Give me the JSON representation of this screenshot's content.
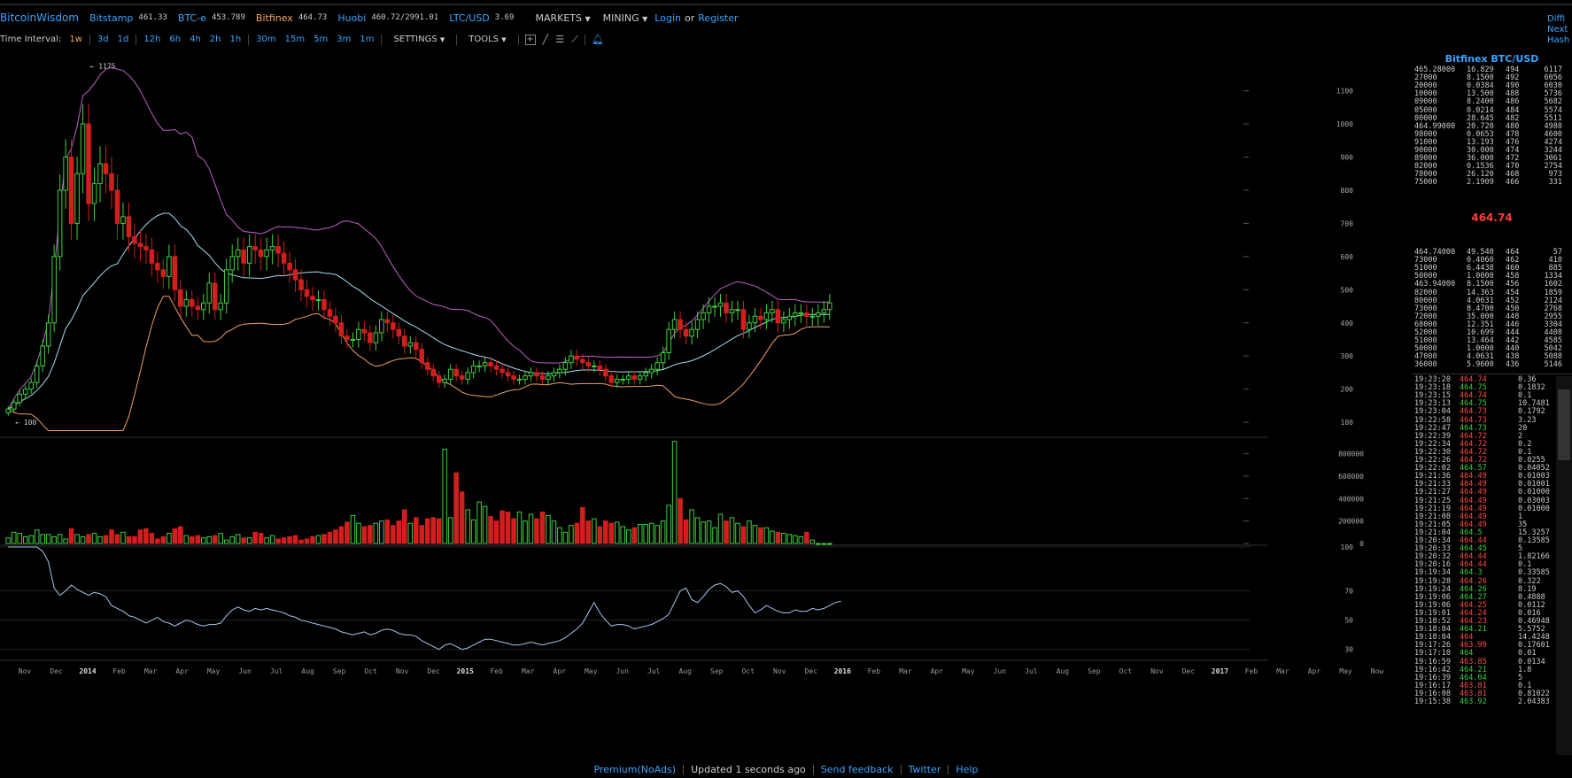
{
  "topbar": {
    "brand": "BitcoinWisdom",
    "exchanges": [
      {
        "name": "Bitstamp",
        "price": "461.33",
        "active": false
      },
      {
        "name": "BTC-e",
        "price": "453.789",
        "active": false
      },
      {
        "name": "Bitfinex",
        "price": "464.73",
        "active": true
      },
      {
        "name": "Huobi",
        "price": "460.72/2991.01",
        "active": false
      },
      {
        "name": "LTC/USD",
        "price": "3.69",
        "active": false
      }
    ],
    "markets_label": "MARKETS",
    "mining_label": "MINING",
    "login_label": "Login",
    "or_label": "or",
    "register_label": "Register",
    "right_links": [
      "Diffi",
      "Next",
      "Hash"
    ]
  },
  "toolbar": {
    "time_interval_label": "Time Interval:",
    "intervals": [
      "1w",
      "3d",
      "1d",
      "12h",
      "6h",
      "4h",
      "2h",
      "1h",
      "30m",
      "15m",
      "5m",
      "3m",
      "1m"
    ],
    "selected_interval": "1w",
    "settings_label": "SETTINGS",
    "tools_label": "TOOLS"
  },
  "colors": {
    "accent": "#3ba4ff",
    "up": "#3dd13d",
    "down": "#d21e1e",
    "bb_upper": "#c060c8",
    "bb_lower": "#f0a060",
    "ma": "#a8dcf0",
    "rsi": "#a8c8f0"
  },
  "chart_data": {
    "type": "candlestick",
    "price_axis": {
      "ticks": [
        100,
        200,
        300,
        400,
        500,
        600,
        700,
        800,
        900,
        1000,
        1100
      ],
      "range": [
        55,
        1235
      ]
    },
    "volume_axis": {
      "ticks": [
        "0",
        "200000",
        "400000",
        "600000",
        "800000"
      ],
      "range": [
        0,
        900000
      ]
    },
    "rsi_axis": {
      "ticks": [
        "30",
        "50",
        "70",
        "100"
      ],
      "range": [
        25,
        100
      ]
    },
    "x_labels": [
      "Nov",
      "Dec",
      "2014",
      "Feb",
      "Mar",
      "Apr",
      "May",
      "Jun",
      "Jul",
      "Aug",
      "Sep",
      "Oct",
      "Nov",
      "Dec",
      "2015",
      "Feb",
      "Mar",
      "Apr",
      "May",
      "Jun",
      "Jul",
      "Aug",
      "Sep",
      "Oct",
      "Nov",
      "Dec",
      "2016",
      "Feb",
      "Mar",
      "Apr",
      "May",
      "Jun",
      "Jul",
      "Aug",
      "Sep",
      "Oct",
      "Nov",
      "Dec",
      "2017",
      "Feb",
      "Mar",
      "Apr",
      "May",
      "Now"
    ],
    "annotations": [
      {
        "text": "1175",
        "value": 1175
      },
      {
        "text": "100",
        "value": 100
      }
    ],
    "closes": [
      140,
      160,
      185,
      200,
      220,
      270,
      330,
      400,
      600,
      800,
      900,
      700,
      850,
      1000,
      760,
      820,
      880,
      850,
      800,
      700,
      720,
      660,
      640,
      630,
      620,
      580,
      560,
      540,
      600,
      500,
      450,
      470,
      450,
      440,
      460,
      520,
      440,
      460,
      560,
      600,
      620,
      580,
      630,
      620,
      600,
      620,
      630,
      610,
      580,
      560,
      530,
      500,
      480,
      470,
      470,
      440,
      420,
      400,
      360,
      350,
      350,
      380,
      370,
      340,
      370,
      410,
      400,
      380,
      360,
      330,
      340,
      320,
      280,
      260,
      240,
      220,
      230,
      260,
      240,
      230,
      250,
      270,
      270,
      280,
      270,
      260,
      250,
      240,
      230,
      230,
      240,
      250,
      240,
      230,
      240,
      250,
      260,
      280,
      300,
      290,
      280,
      270,
      270,
      260,
      240,
      220,
      230,
      230,
      240,
      230,
      240,
      250,
      260,
      280,
      310,
      380,
      410,
      380,
      360,
      380,
      410,
      430,
      450,
      450,
      460,
      430,
      440,
      440,
      380,
      400,
      420,
      410,
      430,
      440,
      400,
      410,
      420,
      430,
      430,
      420,
      420,
      430,
      440,
      460
    ],
    "volumes": [
      50000,
      100000,
      90000,
      60000,
      70000,
      120000,
      80000,
      80000,
      60000,
      80000,
      40000,
      130000,
      80000,
      60000,
      80000,
      90000,
      60000,
      70000,
      120000,
      80000,
      100000,
      60000,
      60000,
      120000,
      130000,
      90000,
      40000,
      60000,
      90000,
      130000,
      150000,
      70000,
      60000,
      70000,
      50000,
      60000,
      70000,
      90000,
      30000,
      60000,
      80000,
      50000,
      50000,
      100000,
      90000,
      50000,
      70000,
      40000,
      50000,
      60000,
      70000,
      30000,
      40000,
      60000,
      70000,
      80000,
      100000,
      120000,
      150000,
      190000,
      250000,
      180000,
      150000,
      160000,
      180000,
      200000,
      210000,
      160000,
      200000,
      300000,
      180000,
      230000,
      160000,
      220000,
      230000,
      220000,
      840000,
      230000,
      630000,
      460000,
      300000,
      210000,
      370000,
      330000,
      240000,
      200000,
      290000,
      280000,
      220000,
      280000,
      200000,
      260000,
      220000,
      280000,
      250000,
      200000,
      140000,
      100000,
      160000,
      180000,
      320000,
      200000,
      220000,
      150000,
      200000,
      180000,
      190000,
      150000,
      120000,
      140000,
      170000,
      170000,
      180000,
      160000,
      200000,
      340000,
      910000,
      400000,
      210000,
      300000,
      230000,
      190000,
      200000,
      140000,
      260000,
      200000,
      230000,
      180000,
      150000,
      200000,
      160000,
      140000,
      140000,
      110000,
      100000,
      90000,
      80000,
      70000,
      60000,
      100000,
      30000
    ],
    "rsi": [
      100,
      100,
      100,
      100,
      100,
      100,
      97,
      90,
      72,
      67,
      70,
      74,
      71,
      69,
      67,
      69,
      68,
      66,
      60,
      58,
      56,
      53,
      52,
      50,
      48,
      50,
      52,
      49,
      48,
      46,
      48,
      50,
      49,
      47,
      46,
      47,
      47,
      48,
      53,
      57,
      59,
      57,
      56,
      58,
      57,
      58,
      57,
      56,
      55,
      53,
      52,
      50,
      49,
      48,
      47,
      46,
      45,
      44,
      42,
      41,
      40,
      41,
      42,
      40,
      41,
      43,
      44,
      43,
      41,
      40,
      40,
      39,
      36,
      34,
      32,
      30,
      33,
      34,
      32,
      30,
      31,
      33,
      35,
      37,
      37,
      36,
      35,
      34,
      33,
      33,
      34,
      35,
      34,
      33,
      34,
      35,
      36,
      38,
      41,
      44,
      48,
      55,
      62,
      55,
      50,
      46,
      47,
      47,
      46,
      44,
      45,
      46,
      47,
      49,
      51,
      54,
      62,
      70,
      72,
      64,
      62,
      66,
      71,
      74,
      75,
      73,
      69,
      70,
      66,
      60,
      55,
      57,
      60,
      58,
      56,
      55,
      55,
      57,
      56,
      56,
      58,
      57,
      58,
      60,
      62,
      63
    ]
  },
  "orderbook": {
    "title": "Bitfinex BTC/USD",
    "asks": [
      [
        "465.28000",
        "16.829",
        "494",
        "6117"
      ],
      [
        "27000",
        "8.1500",
        "492",
        "6056"
      ],
      [
        "20000",
        "0.0384",
        "490",
        "6030"
      ],
      [
        "10000",
        "13.500",
        "488",
        "5736"
      ],
      [
        "09000",
        "8.2400",
        "486",
        "5682"
      ],
      [
        "05000",
        "0.0214",
        "484",
        "5574"
      ],
      [
        "00000",
        "28.645",
        "482",
        "5511"
      ],
      [
        "464.99000",
        "20.720",
        "480",
        "4980"
      ],
      [
        "98000",
        "0.0653",
        "478",
        "4600"
      ],
      [
        "91000",
        "13.193",
        "476",
        "4274"
      ],
      [
        "90000",
        "30.000",
        "474",
        "3244"
      ],
      [
        "89000",
        "36.000",
        "472",
        "3061"
      ],
      [
        "82000",
        "0.1536",
        "470",
        "2754"
      ],
      [
        "78000",
        "26.120",
        "468",
        "973"
      ],
      [
        "75000",
        "2.1909",
        "466",
        "331"
      ]
    ],
    "last_price": "464.74",
    "bids": [
      [
        "464.74000",
        "49.540",
        "464",
        "57"
      ],
      [
        "73000",
        "0.4060",
        "462",
        "410"
      ],
      [
        "51000",
        "6.4438",
        "460",
        "885"
      ],
      [
        "50000",
        "1.0000",
        "458",
        "1334"
      ],
      [
        "463.94000",
        "8.1500",
        "456",
        "1602"
      ],
      [
        "82000",
        "14.363",
        "454",
        "1859"
      ],
      [
        "80000",
        "4.0631",
        "452",
        "2124"
      ],
      [
        "73000",
        "8.4700",
        "450",
        "2768"
      ],
      [
        "72000",
        "35.000",
        "448",
        "2955"
      ],
      [
        "68000",
        "12.351",
        "446",
        "3304"
      ],
      [
        "52000",
        "10.699",
        "444",
        "4408"
      ],
      [
        "51000",
        "13.464",
        "442",
        "4585"
      ],
      [
        "50000",
        "1.0000",
        "440",
        "5042"
      ],
      [
        "47000",
        "4.0631",
        "438",
        "5088"
      ],
      [
        "36000",
        "5.9600",
        "436",
        "5146"
      ]
    ],
    "trades": [
      [
        "19:23:20",
        "464.74",
        "dn",
        "0.36"
      ],
      [
        "19:23:18",
        "464.75",
        "up",
        "0.1832"
      ],
      [
        "19:23:15",
        "464.74",
        "dn",
        "0.1"
      ],
      [
        "19:23:13",
        "464.75",
        "up",
        "10.7481"
      ],
      [
        "19:23:04",
        "464.73",
        "dn",
        "0.1792"
      ],
      [
        "19:22:58",
        "464.73",
        "dn",
        "3.23"
      ],
      [
        "19:22:47",
        "464.73",
        "up",
        "20"
      ],
      [
        "19:22:39",
        "464.72",
        "dn",
        "2"
      ],
      [
        "19:22:34",
        "464.72",
        "dn",
        "0.2"
      ],
      [
        "19:22:30",
        "464.72",
        "dn",
        "0.1"
      ],
      [
        "19:22:26",
        "464.72",
        "dn",
        "0.0255"
      ],
      [
        "19:22:02",
        "464.57",
        "up",
        "0.04052"
      ],
      [
        "19:21:36",
        "464.49",
        "dn",
        "0.01003"
      ],
      [
        "19:21:33",
        "464.49",
        "dn",
        "0.01001"
      ],
      [
        "19:21:27",
        "464.49",
        "dn",
        "0.01000"
      ],
      [
        "19:21:25",
        "464.49",
        "dn",
        "0.03003"
      ],
      [
        "19:21:19",
        "464.49",
        "dn",
        "0.01000"
      ],
      [
        "19:21:08",
        "464.49",
        "dn",
        "1"
      ],
      [
        "19:21:05",
        "464.49",
        "dn",
        "35"
      ],
      [
        "19:21:04",
        "464.5",
        "up",
        "15.3257"
      ],
      [
        "19:20:34",
        "464.44",
        "dn",
        "0.13585"
      ],
      [
        "19:20:33",
        "464.45",
        "up",
        "5"
      ],
      [
        "19:20:32",
        "464.44",
        "dn",
        "1.82166"
      ],
      [
        "19:20:16",
        "464.44",
        "dn",
        "0.1"
      ],
      [
        "19:19:34",
        "464.3",
        "up",
        "0.33585"
      ],
      [
        "19:19:28",
        "464.26",
        "dn",
        "0.322"
      ],
      [
        "19:19:24",
        "464.26",
        "up",
        "8.19"
      ],
      [
        "19:19:06",
        "464.27",
        "up",
        "0.4888"
      ],
      [
        "19:19:06",
        "464.25",
        "dn",
        "0.0112"
      ],
      [
        "19:19:01",
        "464.24",
        "dn",
        "0.016"
      ],
      [
        "19:18:52",
        "464.23",
        "dn",
        "0.46948"
      ],
      [
        "19:18:04",
        "464.21",
        "up",
        "5.5752"
      ],
      [
        "19:18:04",
        "464",
        "dn",
        "14.4248"
      ],
      [
        "19:17:26",
        "463.99",
        "dn",
        "0.17601"
      ],
      [
        "19:17:10",
        "464",
        "up",
        "0.01"
      ],
      [
        "19:16:59",
        "463.85",
        "dn",
        "0.0134"
      ],
      [
        "19:16:42",
        "464.21",
        "up",
        "1.8"
      ],
      [
        "19:16:39",
        "464.04",
        "up",
        "5"
      ],
      [
        "19:16:17",
        "463.81",
        "dn",
        "0.1"
      ],
      [
        "19:16:08",
        "463.81",
        "dn",
        "0.81022"
      ],
      [
        "19:15:38",
        "463.92",
        "up",
        "2.04383"
      ]
    ]
  },
  "footer": {
    "premium": "Premium(NoAds)",
    "updated": "Updated 1 seconds ago",
    "feedback": "Send feedback",
    "twitter": "Twitter",
    "help": "Help"
  }
}
